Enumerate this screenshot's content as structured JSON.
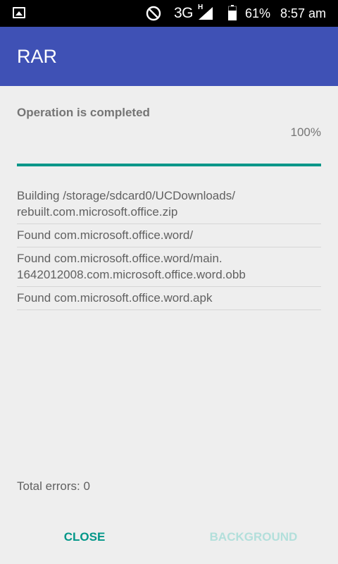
{
  "status_bar": {
    "network": "3G",
    "network_sub": "H",
    "battery_percent": "61%",
    "time": "8:57 am",
    "icons": [
      "image-icon",
      "do-not-disturb-icon",
      "signal-icon",
      "battery-icon"
    ]
  },
  "app_bar": {
    "title": "RAR",
    "color": "#3f51b5"
  },
  "operation": {
    "status": "Operation is completed",
    "percent_label": "100%",
    "progress": 1.0,
    "accent_color": "#009688"
  },
  "log": [
    {
      "lines": [
        "Building /storage/sdcard0/UCDownloads/",
        "rebuilt.com.microsoft.office.zip"
      ]
    },
    {
      "lines": [
        "Found com.microsoft.office.word/"
      ]
    },
    {
      "lines": [
        "Found com.microsoft.office.word/main.",
        "1642012008.com.microsoft.office.word.obb"
      ]
    },
    {
      "lines": [
        "Found com.microsoft.office.word.apk"
      ]
    }
  ],
  "errors": {
    "label": "Total errors: 0"
  },
  "buttons": {
    "close": "CLOSE",
    "background": "BACKGROUND"
  }
}
